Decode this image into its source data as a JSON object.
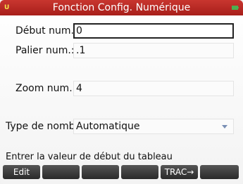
{
  "header": {
    "title": "Fonction Config. Numérique",
    "mode_icon": "U",
    "battery_icon": "battery-icon"
  },
  "fields": {
    "start": {
      "label": "Début num.:",
      "value": "0"
    },
    "step": {
      "label": "Palier num.:",
      "value": ".1"
    },
    "zoom": {
      "label": "Zoom num.:",
      "value": "4"
    },
    "type": {
      "label": "Type de nomb",
      "value": "Automatique"
    }
  },
  "help_text": "Entrer la valeur de début du tableau",
  "softkeys": [
    "Edit",
    "",
    "",
    "",
    "TRAC→",
    ""
  ],
  "colors": {
    "title_bar": "#b82924",
    "softkey": "#3a3a3a",
    "dropdown_arrow": "#7a8fb5"
  }
}
